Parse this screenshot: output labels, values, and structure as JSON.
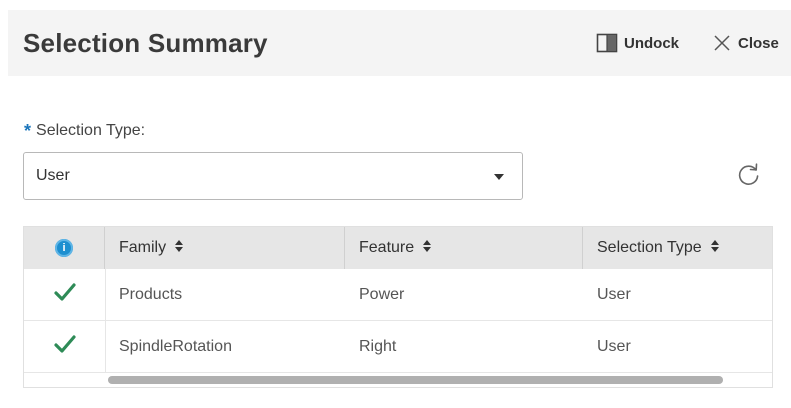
{
  "panel": {
    "title": "Selection Summary",
    "undock_label": "Undock",
    "close_label": "Close"
  },
  "selection_type": {
    "label": "Selection Type:",
    "required_marker": "*",
    "value": "User"
  },
  "table": {
    "info_glyph": "i",
    "columns": [
      "Family",
      "Feature",
      "Selection Type"
    ],
    "rows": [
      {
        "status": "check",
        "family": "Products",
        "feature": "Power",
        "selection_type": "User"
      },
      {
        "status": "check",
        "family": "SpindleRotation",
        "feature": "Right",
        "selection_type": "User"
      }
    ]
  },
  "icons": {
    "undock": "undock-icon",
    "close": "close-icon",
    "dropdown": "chevron-down-icon",
    "refresh": "refresh-icon",
    "info": "info-icon",
    "sort": "sort-icon",
    "row_status": "check-icon"
  },
  "colors": {
    "header_bg": "#f4f4f4",
    "required_star": "#1b75bb",
    "info_blue": "#1d8fd0",
    "check_green": "#2e8b57",
    "table_header_bg": "#e6e6e6"
  }
}
